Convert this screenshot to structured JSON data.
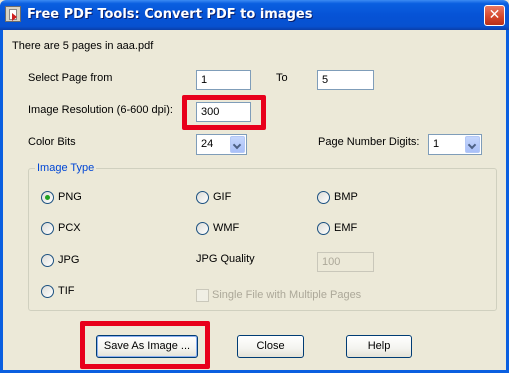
{
  "window": {
    "title": "Free PDF Tools: Convert PDF to images",
    "close_glyph": "✕"
  },
  "info_text": "There are 5 pages in aaa.pdf",
  "page_range": {
    "from_label": "Select Page from",
    "from_value": "1",
    "to_label": "To",
    "to_value": "5"
  },
  "resolution": {
    "label": "Image Resolution (6-600 dpi):",
    "value": "300"
  },
  "color_bits": {
    "label": "Color Bits",
    "value": "24"
  },
  "page_digits": {
    "label": "Page Number Digits:",
    "value": "1"
  },
  "image_type": {
    "label": "Image Type",
    "selected": "PNG",
    "options": [
      "PNG",
      "GIF",
      "BMP",
      "PCX",
      "WMF",
      "EMF",
      "JPG",
      "TIF"
    ]
  },
  "jpg_quality": {
    "label": "JPG Quality",
    "value": "100"
  },
  "single_file": {
    "label": "Single File with Multiple Pages",
    "checked": false
  },
  "buttons": {
    "save": "Save As Image ...",
    "close": "Close",
    "help": "Help"
  },
  "highlight_color": "#E8001C"
}
